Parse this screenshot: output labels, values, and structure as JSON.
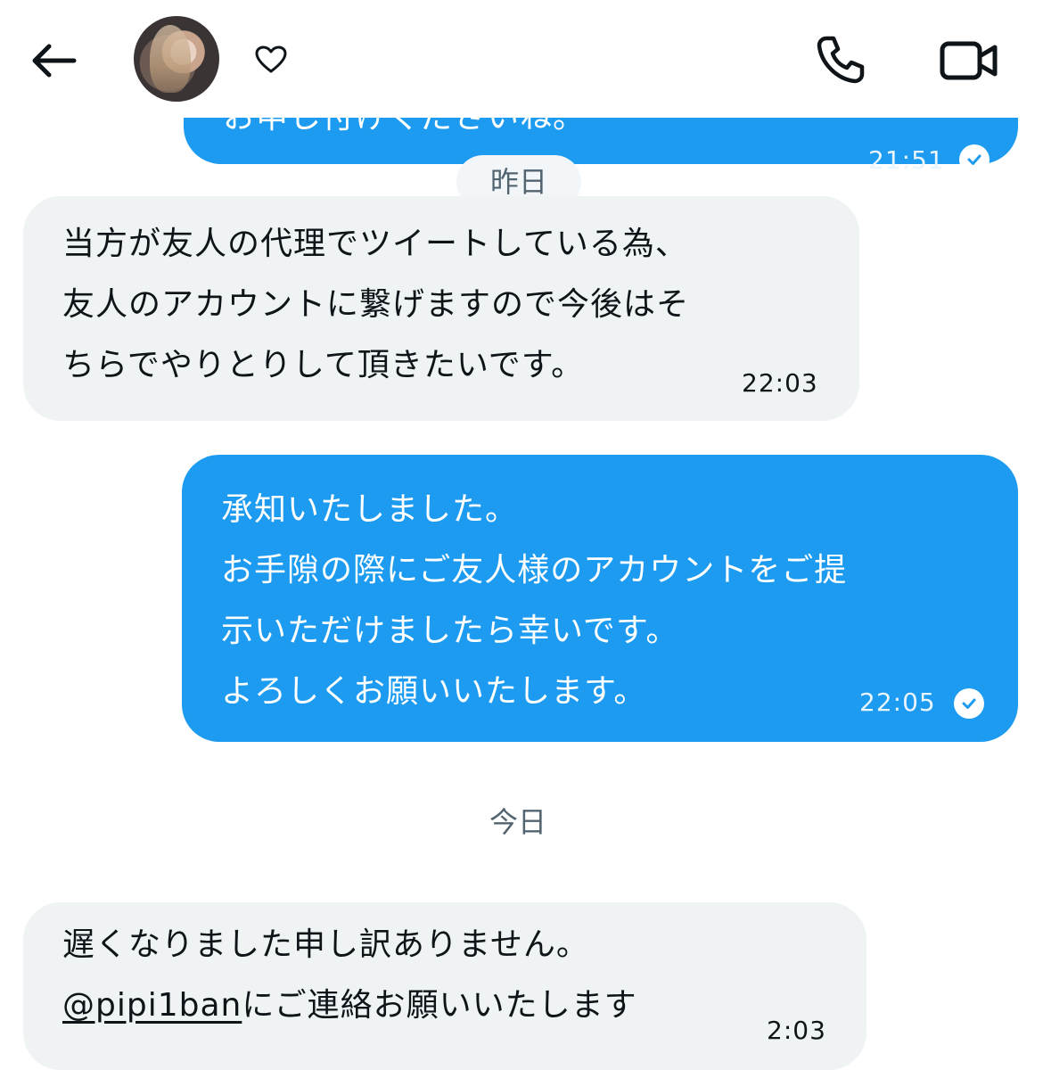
{
  "header": {
    "back_icon": "arrow-left-icon",
    "heart_icon": "heart-outline-icon",
    "phone_icon": "phone-icon",
    "video_icon": "video-camera-icon"
  },
  "colors": {
    "outgoing_bubble": "#1d9bf0",
    "incoming_bubble": "#eff3f4",
    "chip_text": "#536471"
  },
  "messages": {
    "partial_top": {
      "text": "お申し付けくださいね。",
      "time": "21:51"
    },
    "date_yesterday": "昨日",
    "m1": {
      "lines": [
        "当方が友人の代理でツイートしている為、",
        "友人のアカウントに繋げますので今後はそ",
        "ちらでやりとりして頂きたいです。"
      ],
      "time": "22:03"
    },
    "m2": {
      "lines": [
        "承知いたしました。",
        "お手隙の際にご友人様のアカウントをご提",
        "示いただけましたら幸いです。",
        "よろしくお願いいたします。"
      ],
      "time": "22:05"
    },
    "date_today": "今日",
    "m3": {
      "line1": "遅くなりました申し訳ありません。",
      "mention": "@pipi1ban",
      "line2_rest": "にご連絡お願いいたします",
      "time": "2:03"
    }
  }
}
